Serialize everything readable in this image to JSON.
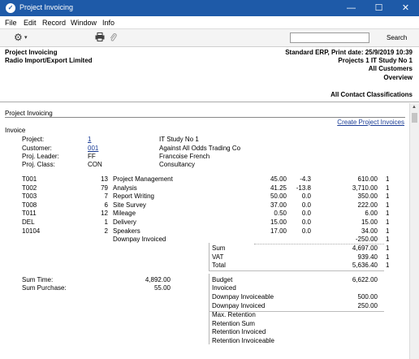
{
  "window": {
    "title": "Project Invoicing",
    "minimize": "—",
    "maximize": "☐",
    "close": "✕"
  },
  "menubar": [
    "File",
    "Edit",
    "Record",
    "Window",
    "Info"
  ],
  "toolbar": {
    "search_label": "Search",
    "search_value": ""
  },
  "header": {
    "left": [
      "Project Invoicing",
      "Radio Import/Export Limited"
    ],
    "right": [
      "Standard ERP, Print date: 25/9/2019 10:39",
      "Projects 1 IT Study No 1",
      "All Customers",
      "Overview",
      "All Contact Classifications"
    ]
  },
  "report": {
    "section_title": "Project Invoicing",
    "create_link": "Create Project Invoices",
    "invoice_label": "Invoice",
    "fields": [
      {
        "label": "Project:",
        "value": "1",
        "desc": "IT Study No 1",
        "link": true
      },
      {
        "label": "Customer:",
        "value": "001",
        "desc": "Against All Odds Trading Co",
        "link": true
      },
      {
        "label": "Proj. Leader:",
        "value": "FF",
        "desc": "Francoise French",
        "link": false
      },
      {
        "label": "Proj. Class:",
        "value": "CON",
        "desc": "Consultancy",
        "link": false
      }
    ],
    "rows": [
      {
        "code": "T001",
        "qty": "13",
        "desc": "Project Management",
        "price": "45.00",
        "disc": "-4.3",
        "sum": "610.00",
        "flag": "1"
      },
      {
        "code": "T002",
        "qty": "79",
        "desc": "Analysis",
        "price": "41.25",
        "disc": "-13.8",
        "sum": "3,710.00",
        "flag": "1"
      },
      {
        "code": "T003",
        "qty": "7",
        "desc": "Report Writing",
        "price": "50.00",
        "disc": "0.0",
        "sum": "350.00",
        "flag": "1"
      },
      {
        "code": "T008",
        "qty": "6",
        "desc": "Site Survey",
        "price": "37.00",
        "disc": "0.0",
        "sum": "222.00",
        "flag": "1"
      },
      {
        "code": "T011",
        "qty": "12",
        "desc": "Mileage",
        "price": "0.50",
        "disc": "0.0",
        "sum": "6.00",
        "flag": "1"
      },
      {
        "code": "DEL",
        "qty": "1",
        "desc": "Delivery",
        "price": "15.00",
        "disc": "0.0",
        "sum": "15.00",
        "flag": "1"
      },
      {
        "code": "10104",
        "qty": "2",
        "desc": "Speakers",
        "price": "17.00",
        "disc": "0.0",
        "sum": "34.00",
        "flag": "1"
      },
      {
        "code": "",
        "qty": "",
        "desc": "Downpay Invoiced",
        "price": "",
        "disc": "",
        "sum": "-250.00",
        "flag": "1"
      }
    ],
    "totals": [
      {
        "label": "Sum",
        "value": "4,697.00",
        "flag": "1"
      },
      {
        "label": "VAT",
        "value": "939.40",
        "flag": "1"
      },
      {
        "label": "Total",
        "value": "5,636.40",
        "flag": "1"
      }
    ],
    "left_summary": [
      {
        "label": "Sum Time:",
        "value": "4,892.00"
      },
      {
        "label": "Sum Purchase:",
        "value": "55.00"
      }
    ],
    "right_summary": [
      {
        "label": "Budget",
        "value": "6,622.00"
      },
      {
        "label": "Invoiced",
        "value": ""
      },
      {
        "label": "Downpay Invoiceable",
        "value": "500.00"
      },
      {
        "label": "Downpay Invoiced",
        "value": "250.00"
      }
    ],
    "retention": [
      "Max. Retention",
      "Retention Sum",
      "Retention Invoiced",
      "Retention Invoiceable"
    ]
  }
}
